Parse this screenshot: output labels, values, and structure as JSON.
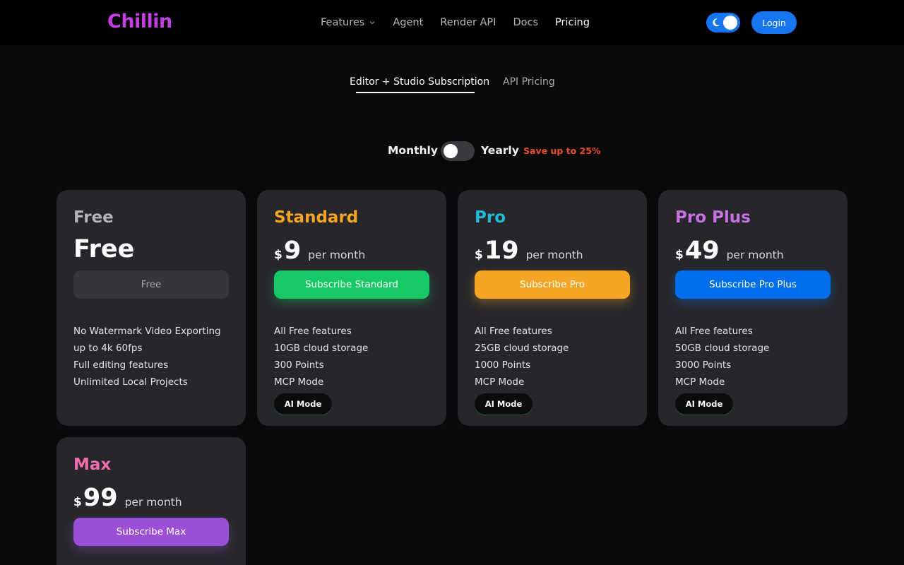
{
  "brand": {
    "logo_text": "Chillin",
    "logo_color": "#c13ee0"
  },
  "nav": {
    "links": [
      {
        "label": "Features",
        "has_dropdown": true
      },
      {
        "label": "Agent"
      },
      {
        "label": "Render API"
      },
      {
        "label": "Docs"
      },
      {
        "label": "Pricing",
        "active": true
      }
    ],
    "theme_toggle": {
      "icon": "moon-icon",
      "state": "dark"
    },
    "login_label": "Login"
  },
  "tabs": [
    {
      "label": "Editor + Studio Subscription",
      "active": true
    },
    {
      "label": "API Pricing"
    }
  ],
  "billing": {
    "monthly_label": "Monthly",
    "yearly_label": "Yearly",
    "selected": "Monthly",
    "save_text": "Save up to 25%"
  },
  "plans": [
    {
      "name": "Free",
      "name_color": "#b4b4b8",
      "price": "Free",
      "cta": "Free",
      "features": [
        "No Watermark Video Exporting",
        "up to 4k 60fps",
        "Full editing features",
        "Unlimited Local Projects"
      ]
    },
    {
      "name": "Standard",
      "name_color": "#f5a524",
      "currency": "$",
      "price": "9",
      "period": "per month",
      "cta": "Subscribe Standard",
      "cta_color": "#17c964",
      "features": [
        "All Free features",
        "10GB cloud storage",
        "300 Points",
        "MCP Mode"
      ],
      "badge": "AI Mode"
    },
    {
      "name": "Pro",
      "name_color": "#22b8d8",
      "currency": "$",
      "price": "19",
      "period": "per month",
      "cta": "Subscribe Pro",
      "cta_color": "#f5a524",
      "features": [
        "All Free features",
        "25GB cloud storage",
        "1000 Points",
        "MCP Mode"
      ],
      "badge": "AI Mode"
    },
    {
      "name": "Pro Plus",
      "name_color": "#c76ee0",
      "currency": "$",
      "price": "49",
      "period": "per month",
      "cta": "Subscribe Pro Plus",
      "cta_color": "#006fee",
      "features": [
        "All Free features",
        "50GB cloud storage",
        "3000 Points",
        "MCP Mode"
      ],
      "badge": "AI Mode"
    },
    {
      "name": "Max",
      "name_color": "#f06eae",
      "currency": "$",
      "price": "99",
      "period": "per month",
      "cta": "Subscribe Max",
      "cta_color": "#9b4fd6"
    }
  ]
}
